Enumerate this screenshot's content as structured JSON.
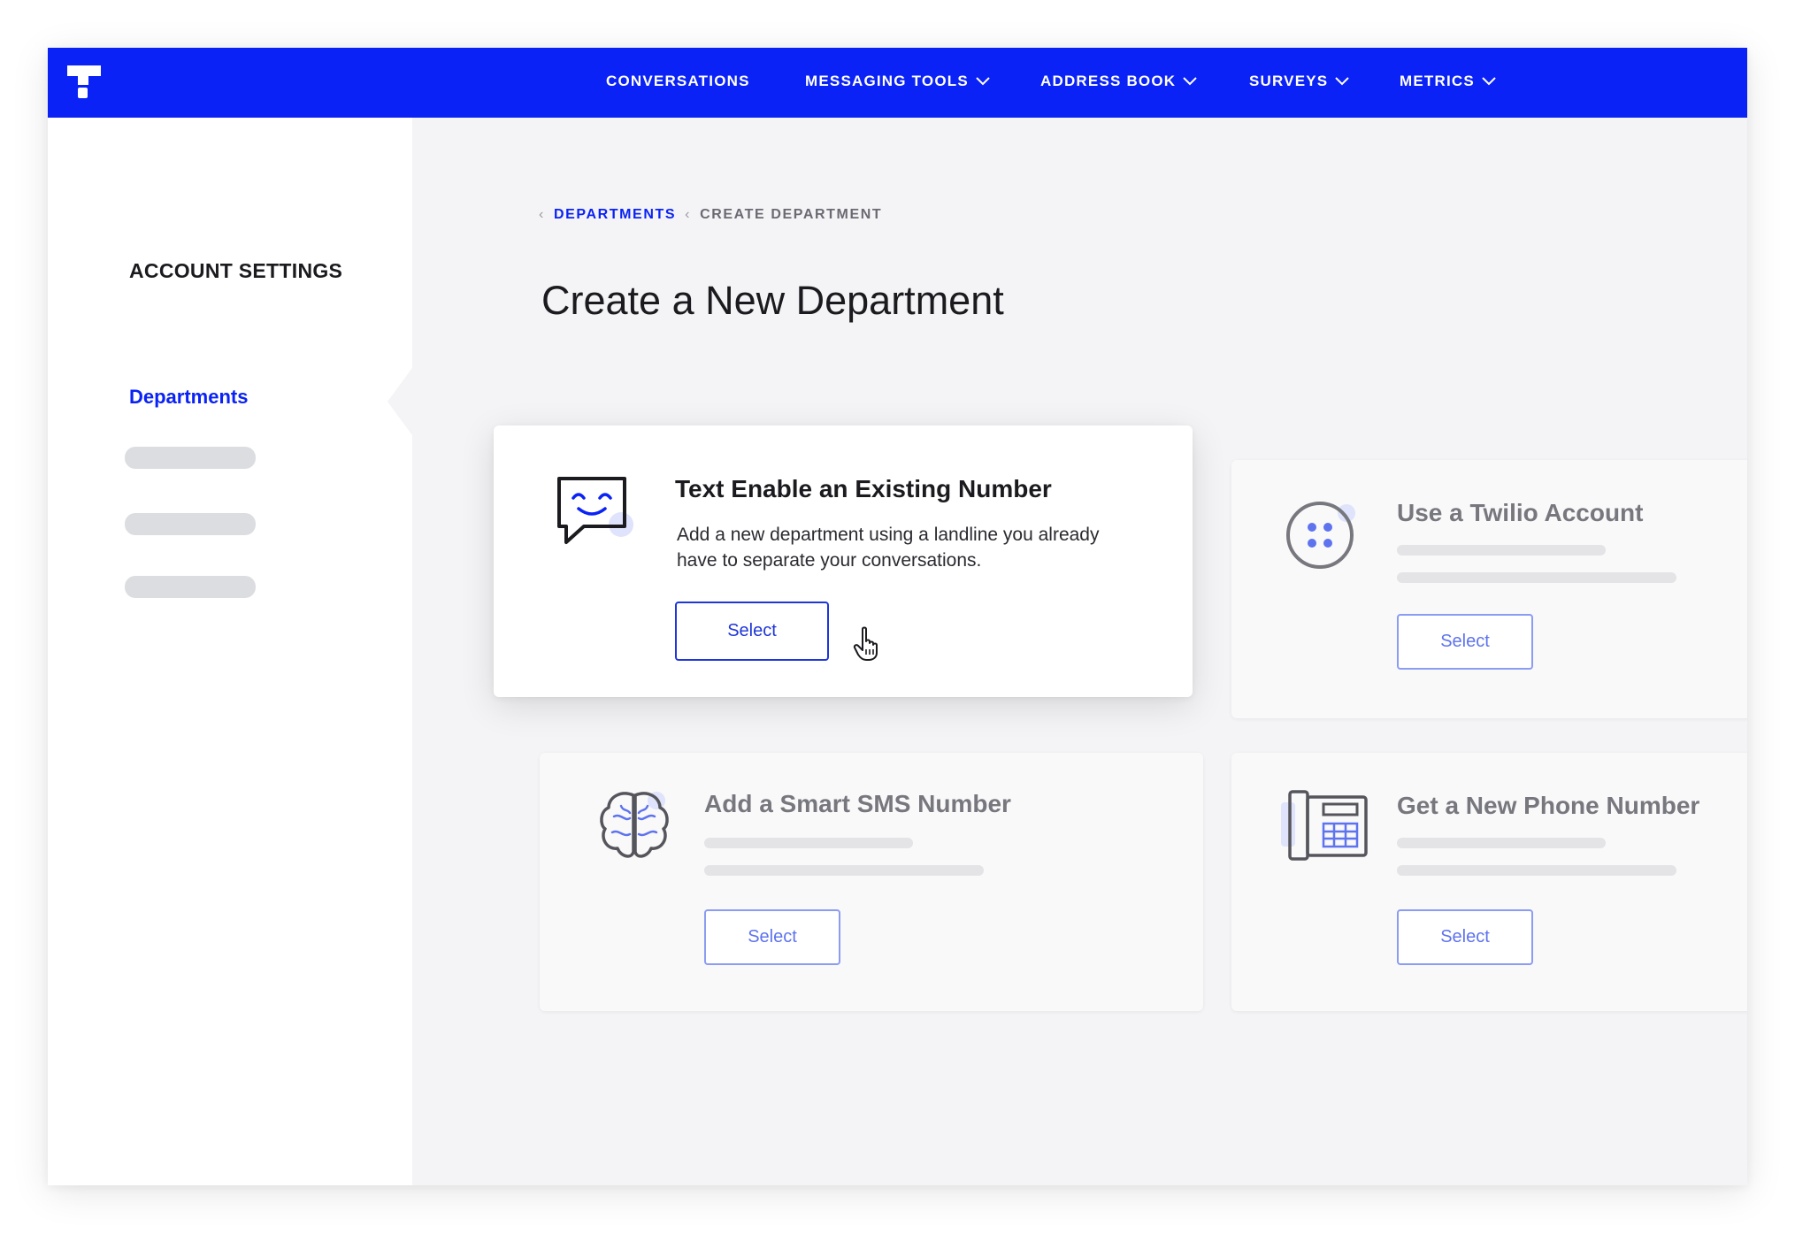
{
  "nav": {
    "items": [
      {
        "label": "CONVERSATIONS",
        "dropdown": false
      },
      {
        "label": "MESSAGING TOOLS",
        "dropdown": true
      },
      {
        "label": "ADDRESS BOOK",
        "dropdown": true
      },
      {
        "label": "SURVEYS",
        "dropdown": true
      },
      {
        "label": "METRICS",
        "dropdown": true
      }
    ]
  },
  "sidebar": {
    "title": "ACCOUNT SETTINGS",
    "active_item": "Departments"
  },
  "breadcrumb": {
    "parent": "DEPARTMENTS",
    "current": "CREATE DEPARTMENT"
  },
  "page": {
    "title": "Create a New Department"
  },
  "cards": [
    {
      "title": "Text Enable an Existing Number",
      "description": "Add a new department using a landline you already have to separate your conversations.",
      "button_label": "Select",
      "icon": "smiling-chat-bubble-icon",
      "active": true
    },
    {
      "title": "Use a Twilio Account",
      "button_label": "Select",
      "icon": "twilio-logo-icon",
      "active": false
    },
    {
      "title": "Add a Smart SMS Number",
      "button_label": "Select",
      "icon": "brain-icon",
      "active": false
    },
    {
      "title": "Get a New Phone Number",
      "button_label": "Select",
      "icon": "desk-phone-icon",
      "active": false
    }
  ],
  "colors": {
    "brand_blue": "#0a22f5",
    "accent_light": "#8b9cf3",
    "background": "#f4f4f6"
  }
}
